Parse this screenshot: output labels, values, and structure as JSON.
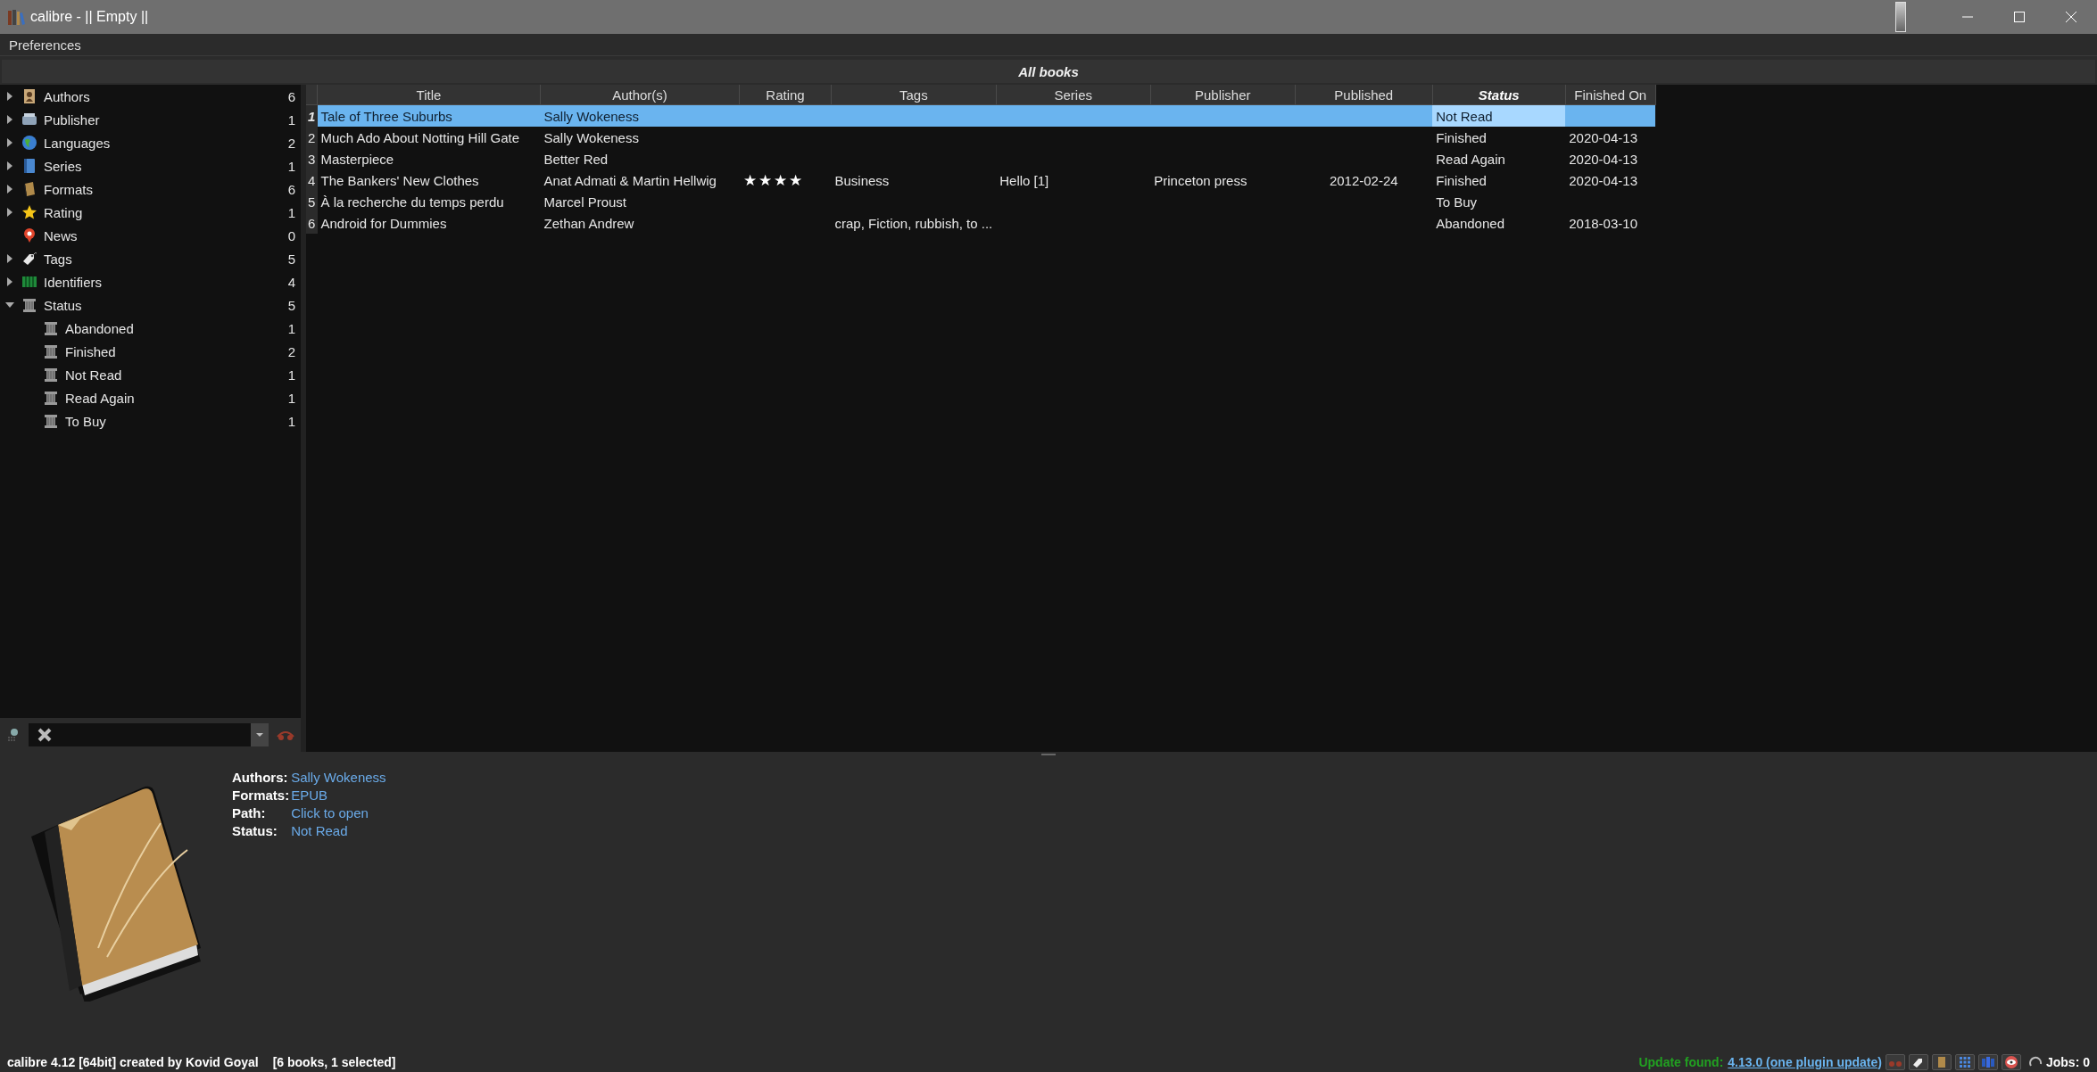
{
  "window": {
    "title": "calibre - || Empty ||"
  },
  "menu": [
    "Preferences"
  ],
  "library_view": {
    "title": "All books"
  },
  "sidebar": {
    "items": [
      {
        "label": "Authors",
        "count": "6",
        "kind": "authors",
        "expandable": true,
        "expanded": false
      },
      {
        "label": "Publisher",
        "count": "1",
        "kind": "publisher",
        "expandable": true,
        "expanded": false
      },
      {
        "label": "Languages",
        "count": "2",
        "kind": "languages",
        "expandable": true,
        "expanded": false
      },
      {
        "label": "Series",
        "count": "1",
        "kind": "series",
        "expandable": true,
        "expanded": false
      },
      {
        "label": "Formats",
        "count": "6",
        "kind": "formats",
        "expandable": true,
        "expanded": false
      },
      {
        "label": "Rating",
        "count": "1",
        "kind": "rating",
        "expandable": true,
        "expanded": false
      },
      {
        "label": "News",
        "count": "0",
        "kind": "news",
        "expandable": false
      },
      {
        "label": "Tags",
        "count": "5",
        "kind": "tags",
        "expandable": true,
        "expanded": false
      },
      {
        "label": "Identifiers",
        "count": "4",
        "kind": "identifiers",
        "expandable": true,
        "expanded": false
      },
      {
        "label": "Status",
        "count": "5",
        "kind": "status",
        "expandable": true,
        "expanded": true,
        "children": [
          {
            "label": "Abandoned",
            "count": "1",
            "kind": "status"
          },
          {
            "label": "Finished",
            "count": "2",
            "kind": "status"
          },
          {
            "label": "Not Read",
            "count": "1",
            "kind": "status"
          },
          {
            "label": "Read Again",
            "count": "1",
            "kind": "status"
          },
          {
            "label": "To Buy",
            "count": "1",
            "kind": "status"
          }
        ]
      }
    ]
  },
  "table": {
    "columns": [
      {
        "label": "Title",
        "kind": "text",
        "sorted": false
      },
      {
        "label": "Author(s)",
        "kind": "text",
        "sorted": false
      },
      {
        "label": "Rating",
        "kind": "rating",
        "sorted": false
      },
      {
        "label": "Tags",
        "kind": "text",
        "sorted": false
      },
      {
        "label": "Series",
        "kind": "text",
        "sorted": false
      },
      {
        "label": "Publisher",
        "kind": "text",
        "sorted": false
      },
      {
        "label": "Published",
        "kind": "date",
        "sorted": false
      },
      {
        "label": "Status",
        "kind": "text",
        "sorted": true
      },
      {
        "label": "Finished On",
        "kind": "text",
        "sorted": false
      }
    ],
    "rows": [
      {
        "number": "1",
        "selected": true,
        "cells": [
          "Tale of Three Suburbs",
          "Sally Wokeness",
          "",
          "",
          "",
          "",
          "",
          "Not Read",
          ""
        ]
      },
      {
        "number": "2",
        "selected": false,
        "cells": [
          "Much Ado About Notting Hill Gate",
          "Sally Wokeness",
          "",
          "",
          "",
          "",
          "",
          "Finished",
          "2020-04-13"
        ]
      },
      {
        "number": "3",
        "selected": false,
        "cells": [
          "Masterpiece",
          "Better Red",
          "",
          "",
          "",
          "",
          "",
          "Read Again",
          "2020-04-13"
        ]
      },
      {
        "number": "4",
        "selected": false,
        "stars": 4,
        "cells": [
          "The Bankers' New Clothes",
          "Anat Admati & Martin Hellwig",
          "",
          "Business",
          "Hello [1]",
          "Princeton press",
          "2012-02-24",
          "Finished",
          "2020-04-13"
        ]
      },
      {
        "number": "5",
        "selected": false,
        "cells": [
          "À la recherche du temps perdu",
          "Marcel Proust",
          "",
          "",
          "",
          "",
          "",
          "To Buy",
          ""
        ]
      },
      {
        "number": "6",
        "selected": false,
        "cells": [
          "Android for Dummies",
          "Zethan Andrew",
          "",
          "crap, Fiction, rubbish, to ...",
          "",
          "",
          "",
          "Abandoned",
          "2018-03-10"
        ]
      }
    ]
  },
  "details": {
    "fields": [
      {
        "label": "Authors:",
        "value": "Sally Wokeness"
      },
      {
        "label": "Formats:",
        "value": "EPUB"
      },
      {
        "label": "Path:",
        "value": "Click to open"
      },
      {
        "label": "Status:",
        "value": "Not Read"
      }
    ]
  },
  "status_bar": {
    "version": "calibre 4.12 [64bit] created by Kovid Goyal",
    "selection": "[6 books, 1 selected]",
    "update_label": "Update found:",
    "update_link": "4.13.0 (one plugin update)",
    "jobs": "Jobs: 0"
  }
}
